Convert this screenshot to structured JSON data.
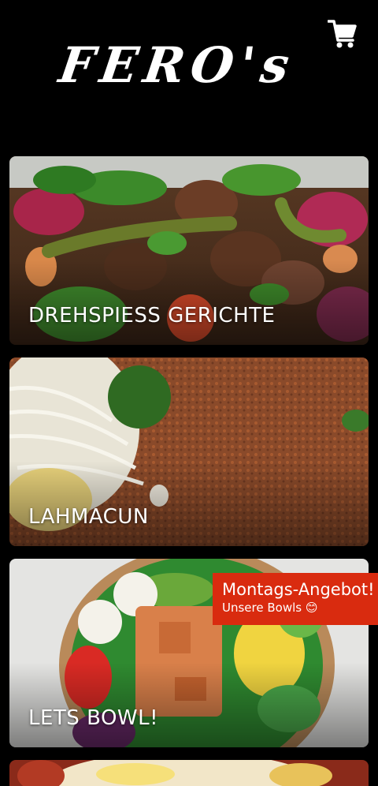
{
  "header": {
    "logo_text": "FERO's",
    "cart_icon": "shopping-cart-icon"
  },
  "categories": [
    {
      "label": "DREHSPIESS GERICHTE"
    },
    {
      "label": "LAHMACUN"
    },
    {
      "label": "LETS BOWL!"
    },
    {
      "label": ""
    }
  ],
  "promo": {
    "title": "Montags-Angebot!",
    "subtitle": "Unsere Bowls 😊"
  },
  "colors": {
    "background": "#000000",
    "promo_background": "#d92b0f",
    "text": "#ffffff"
  }
}
